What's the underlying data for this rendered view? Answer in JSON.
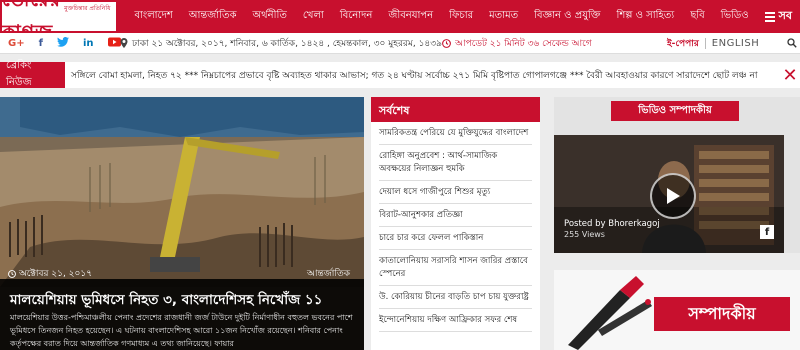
{
  "brand": {
    "tagline": "মুক্তচিন্তার প্রতিনিধি",
    "name": "ভোরের কাগজ",
    "accent": "#c8102e"
  },
  "nav": {
    "items": [
      "বাংলাদেশ",
      "আন্তর্জাতিক",
      "অর্থনীতি",
      "খেলা",
      "বিনোদন",
      "জীবনযাপন",
      "ফিচার",
      "মতামত",
      "বিজ্ঞান ও প্রযুক্তি",
      "শিল্প ও সাহিত্য",
      "ছবি",
      "ভিডিও"
    ],
    "menu_label": "সব"
  },
  "infobar": {
    "date": "ঢাকা ২১ অক্টোবর, ২০১৭, শনিবার, ৬ কার্তিক, ১৪২৪ , হেমন্তকাল, ৩০ মুহররম, ১৪৩৯",
    "update": "আপডেট ২১ মিনিট ৩৬ সেকেন্ড আগে",
    "epaper": "ই-পেপার",
    "lang": "ENGLISH",
    "social_icons": [
      "google-plus",
      "facebook",
      "twitter",
      "linkedin",
      "youtube"
    ]
  },
  "breaking": {
    "label": "ব্রেকিং নিউজ",
    "ticker": "সঙ্গিলে বোমা হামলা, নিহত ৭২ *** নিম্নচাপের প্রভাবে বৃষ্টি অব্যাহত থাকার আভাস; গত ২৪ ঘণ্টায় সর্বোচ্চ ২৭১ মিমি বৃষ্টিপাত গোপালগঞ্জে *** বৈরী আবহাওয়ার কারণে সারাদেশে ছোট লঞ্চ না"
  },
  "hero": {
    "date": "অক্টোবর ২১, ২০১৭",
    "category": "আন্তর্জাতিক",
    "title": "মালয়েশিয়ায় ভূমিধসে নিহত ৩, বাংলাদেশিসহ নিখোঁজ ১১",
    "body": "মালয়েশিয়ার উত্তর-পশ্চিমাঞ্চলীয় পেনাং প্রদেশের রাজধানী জর্জ টাউনে দুইটি নির্মাণাধীন বহুতল ভবনের পাশে ভূমিধসে তিনজন নিহত হয়েছেন। এ ঘটনায় বাংলাদেশিসহ আরো ১১জন নিখোঁজ রয়েছেন। শনিবার পেনাং কর্তৃপক্ষের বরাত দিয়ে আন্তর্জাতিক গণমাধ্যম এ তথ্য জানিয়েছে। ফায়ার"
  },
  "latest": {
    "heading": "সর্বশেষ",
    "items": [
      "সামরিকতন্ত্র পেরিয়ে যে মুক্তিযুদ্ধের বাংলাদেশ",
      "রোহিঙ্গা অনুপ্রবেশ : আর্থ-সামাজিক অবক্ষয়ের নিলাজ্ঞন হুমকি",
      "দেয়াল ধসে গাজীপুরে শিশুর মৃত্যু",
      "বিরাট-আনুশকার প্রতিজ্ঞা",
      "চারে চার করে ফেলল পাকিস্তান",
      "কাতালোনিয়ায় সরাসরি শাসন জারির প্রস্তাবে স্পেনের",
      "উ. কোরিয়ায় চীনের বাড়তি চাপ চায় যুক্তরাষ্ট্র",
      "ইন্দোনেশিয়ায় দক্ষিণ আফ্রিকার সফর শেষ"
    ]
  },
  "video": {
    "heading": "ভিডিও সম্পাদকীয়",
    "posted_by": "Posted by Bhorerkagoj",
    "views": "255 Views"
  },
  "editorial": {
    "heading": "সম্পাদকীয়"
  }
}
